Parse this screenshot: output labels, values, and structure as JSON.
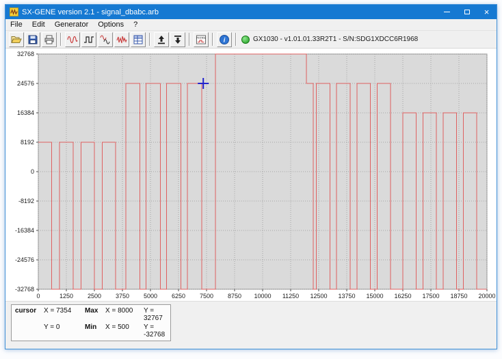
{
  "window": {
    "title": "SX-GENE version 2.1 - signal_dbabc.arb"
  },
  "menu": {
    "items": [
      "File",
      "Edit",
      "Generator",
      "Options",
      "?"
    ]
  },
  "toolbar": {
    "icons": [
      "open-file",
      "save-file",
      "print",
      "sine-wave",
      "step-wave",
      "dual-tone-wave",
      "noise-wave",
      "sequence-table",
      "upload-to-device",
      "download-from-device",
      "pattern-mode",
      "info",
      "status-led"
    ],
    "status": {
      "text": "GX1030 - v1.01.01.33R2T1 - S/N:SDG1XDCC6R1968",
      "led_color": "#1d9b1d"
    }
  },
  "chart_data": {
    "type": "line",
    "title": "",
    "xlabel": "",
    "ylabel": "",
    "xlim": [
      0,
      20000
    ],
    "ylim": [
      -32768,
      32768
    ],
    "x_ticks": [
      0,
      1250,
      2500,
      3750,
      5000,
      6250,
      7500,
      8750,
      10000,
      11250,
      12500,
      13750,
      15000,
      16250,
      17500,
      18750,
      20000
    ],
    "y_ticks": [
      32768,
      24576,
      16384,
      8192,
      0,
      -8192,
      -16384,
      -24576,
      -32768
    ],
    "grid": true,
    "baseline": -32768,
    "pulses": [
      [
        0,
        600,
        8192
      ],
      [
        950,
        1550,
        8192
      ],
      [
        1900,
        2500,
        8192
      ],
      [
        2850,
        3450,
        8192
      ],
      [
        3900,
        4530,
        24576
      ],
      [
        4800,
        5440,
        24576
      ],
      [
        5720,
        6360,
        24576
      ],
      [
        6640,
        7280,
        24576
      ],
      [
        7900,
        11950,
        32767
      ],
      [
        11950,
        12250,
        24576
      ],
      [
        12400,
        13000,
        24576
      ],
      [
        13300,
        13900,
        24576
      ],
      [
        14200,
        14800,
        24576
      ],
      [
        15100,
        15700,
        24576
      ],
      [
        16250,
        16850,
        16384
      ],
      [
        17150,
        17750,
        16384
      ],
      [
        18050,
        18650,
        16384
      ],
      [
        18950,
        19550,
        16384
      ]
    ],
    "cursor_marker": {
      "x": 7354,
      "y": 24576
    },
    "line_color": "#df6060",
    "cursor_color": "#2222cc",
    "plot_bg": "#dadada",
    "plot_border": "#8c8c8c",
    "grid_color": "#a6a6a6"
  },
  "readout": {
    "cursor_label": "cursor",
    "cursor_x": "X = 7354",
    "cursor_y": "Y = 0",
    "max_label": "Max",
    "max_x": "X = 8000",
    "max_y": "Y = 32767",
    "min_label": "Min",
    "min_x": "X = 500",
    "min_y": "Y = -32768"
  }
}
